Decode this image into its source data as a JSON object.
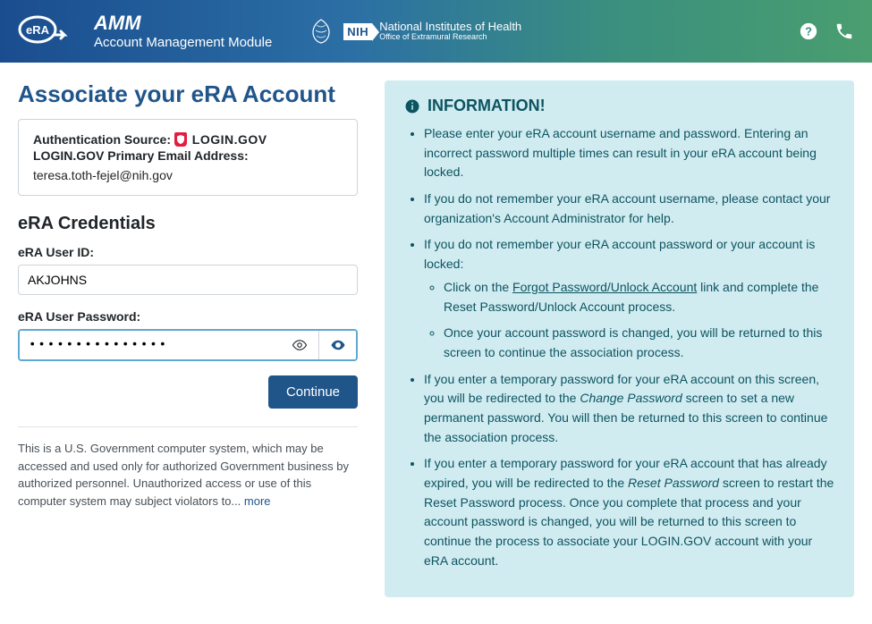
{
  "header": {
    "app_title": "AMM",
    "app_subtitle": "Account Management Module",
    "nih_main": "National Institutes of Health",
    "nih_sub": "Office of Extramural Research",
    "nih_box": "NIH"
  },
  "page": {
    "title": "Associate your eRA Account"
  },
  "auth": {
    "source_label": "Authentication Source:",
    "source_value": "LOGIN.GOV",
    "email_label": "LOGIN.GOV Primary Email Address:",
    "email_value": "teresa.toth-fejel@nih.gov"
  },
  "credentials": {
    "section_title": "eRA Credentials",
    "userid_label": "eRA User ID:",
    "userid_value": "AKJOHNS",
    "password_label": "eRA User Password:",
    "password_display": "•••••••••••••••",
    "continue_label": "Continue"
  },
  "disclaimer": {
    "text": "This is a U.S. Government computer system, which may be accessed and used only for authorized Government business by authorized personnel. Unauthorized access or use of this computer system may subject violators to...",
    "more_label": "more"
  },
  "info": {
    "heading": "INFORMATION!",
    "b1": "Please enter your eRA account username and password. Entering an incorrect password multiple times can result in your eRA account being locked.",
    "b2": "If you do not remember your eRA account username, please contact your organization's Account Administrator for help.",
    "b3": "If you do not remember your eRA account password or your account is locked:",
    "b3a_pre": "Click on the ",
    "b3a_link": "Forgot Password/Unlock Account",
    "b3a_post": " link and complete the Reset Password/Unlock Account process.",
    "b3b": "Once your account password is changed, you will be returned to this screen to continue the association process.",
    "b4_pre": "If you enter a temporary password for your eRA account on this screen, you will be redirected to the ",
    "b4_italic": "Change Password",
    "b4_post": " screen to set a new permanent password. You will then be returned to this screen to continue the association process.",
    "b5_pre": "If you enter a temporary password for your eRA account that has already expired, you will be redirected to the ",
    "b5_italic": "Reset Password",
    "b5_post": " screen to restart the Reset Password process. Once you complete that process and your account password is changed, you will be returned to this screen to continue the process to associate your LOGIN.GOV account with your eRA account."
  }
}
